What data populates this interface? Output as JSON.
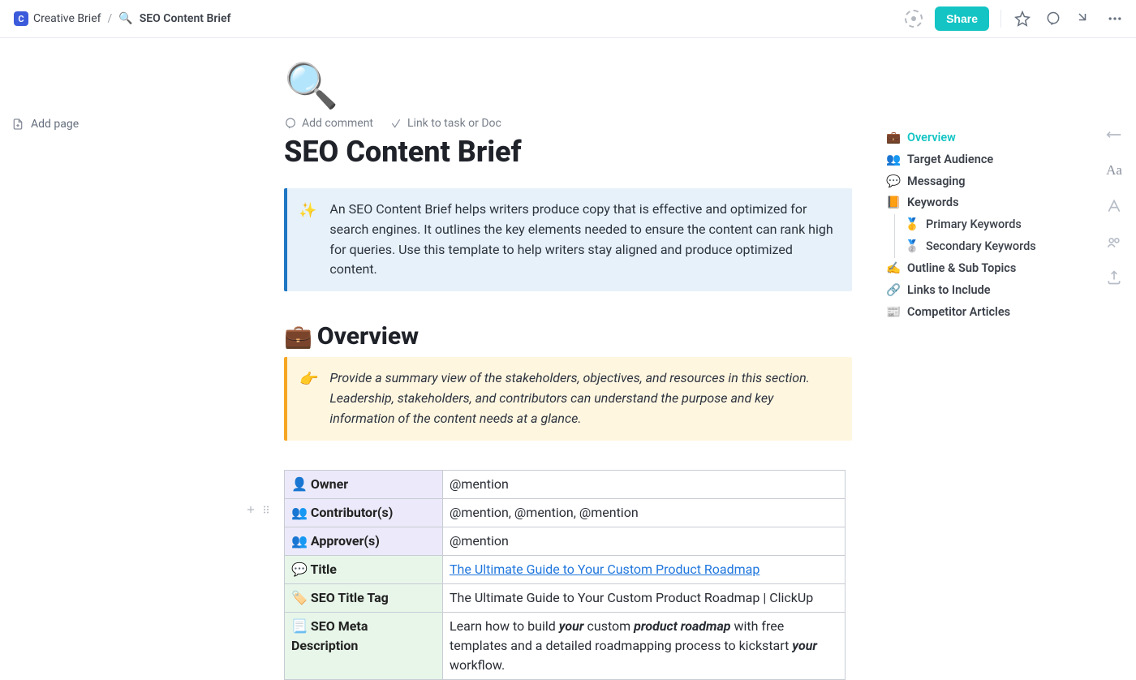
{
  "breadcrumbs": {
    "icon_letter": "C",
    "parent": "Creative Brief",
    "current_emoji": "🔍",
    "current": "SEO Content Brief"
  },
  "topbar": {
    "share_label": "Share"
  },
  "left": {
    "add_page": "Add page"
  },
  "doc": {
    "page_emoji": "🔍",
    "add_comment": "Add comment",
    "link_to": "Link to task or Doc",
    "title": "SEO Content Brief",
    "intro_callout": {
      "emoji": "✨",
      "text": "An SEO Content Brief helps writers produce copy that is effective and optimized for search engines. It outlines the key elements needed to ensure the content can rank high for queries. Use this template to help writers stay aligned and produce optimized content."
    },
    "overview_heading_emoji": "💼",
    "overview_heading": "Overview",
    "overview_callout": {
      "emoji": "👉",
      "text": "Provide a summary view of the stakeholders, objectives, and resources in this section. Leadership, stakeholders, and contributors can understand the purpose and key information of the content needs at a glance."
    },
    "table": {
      "owner_label": "👤 Owner",
      "owner_value": "@mention",
      "contributors_label": "👥 Contributor(s)",
      "contributors_value": "@mention, @mention, @mention",
      "approvers_label": "👥 Approver(s)",
      "approvers_value": "@mention",
      "title_label": "💬 Title",
      "title_link": "The Ultimate Guide to Your Custom Product Roadmap",
      "seo_title_label": "🏷️ SEO Title Tag",
      "seo_title_value": "The Ultimate Guide to Your Custom Product Roadmap | ClickUp",
      "meta_label": "📃 SEO Meta Description",
      "meta_1": "Learn how to build ",
      "meta_your1": "your",
      "meta_2": " custom ",
      "meta_product_roadmap": "product roadmap",
      "meta_3": " with free templates and a detailed roadmapping process to kickstart ",
      "meta_your2": "your",
      "meta_4": " workflow."
    }
  },
  "toc": {
    "items": [
      {
        "emoji": "💼",
        "label": "Overview",
        "active": true
      },
      {
        "emoji": "👥",
        "label": "Target Audience"
      },
      {
        "emoji": "💬",
        "label": "Messaging"
      },
      {
        "emoji": "📙",
        "label": "Keywords"
      },
      {
        "emoji": "🥇",
        "label": "Primary Keywords",
        "sub": true
      },
      {
        "emoji": "🥈",
        "label": "Secondary Keywords",
        "sub": true
      },
      {
        "emoji": "✍️",
        "label": "Outline & Sub Topics"
      },
      {
        "emoji": "🔗",
        "label": "Links to Include"
      },
      {
        "emoji": "📰",
        "label": "Competitor Articles"
      }
    ]
  }
}
